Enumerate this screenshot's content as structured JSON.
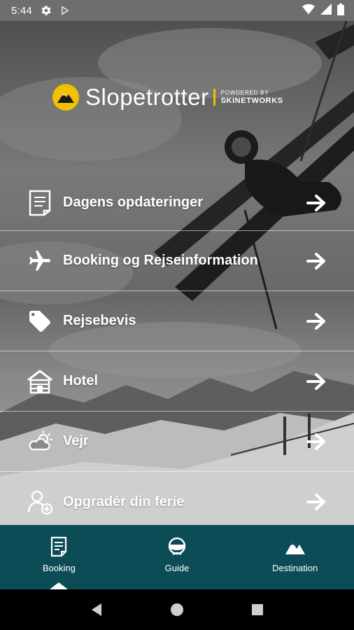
{
  "status_bar": {
    "time": "5:44",
    "icons": [
      "gear-icon",
      "play-store-icon",
      "wifi-icon",
      "signal-icon",
      "battery-icon"
    ]
  },
  "brand": {
    "name": "Slopetrotter",
    "powered_by": "POWDERED BY",
    "partner": "SKINETWORKS",
    "accent_color": "#f2c200"
  },
  "menu": {
    "items": [
      {
        "label": "Dagens opdateringer",
        "icon": "document-icon"
      },
      {
        "label": "Booking og Rejseinformation",
        "icon": "airplane-icon"
      },
      {
        "label": "Rejsebevis",
        "icon": "tag-icon"
      },
      {
        "label": "Hotel",
        "icon": "hotel-icon"
      },
      {
        "label": "Vejr",
        "icon": "weather-icon"
      },
      {
        "label": "Opgradér din ferie",
        "icon": "add-user-icon"
      }
    ]
  },
  "bottom_nav": {
    "background": "#0c4c57",
    "tabs": [
      {
        "label": "Booking",
        "icon": "document-icon",
        "active": true
      },
      {
        "label": "Guide",
        "icon": "skier-icon",
        "active": false
      },
      {
        "label": "Destination",
        "icon": "mountain-icon",
        "active": false
      }
    ]
  },
  "system_nav": {
    "buttons": [
      "back",
      "home",
      "recents"
    ]
  }
}
